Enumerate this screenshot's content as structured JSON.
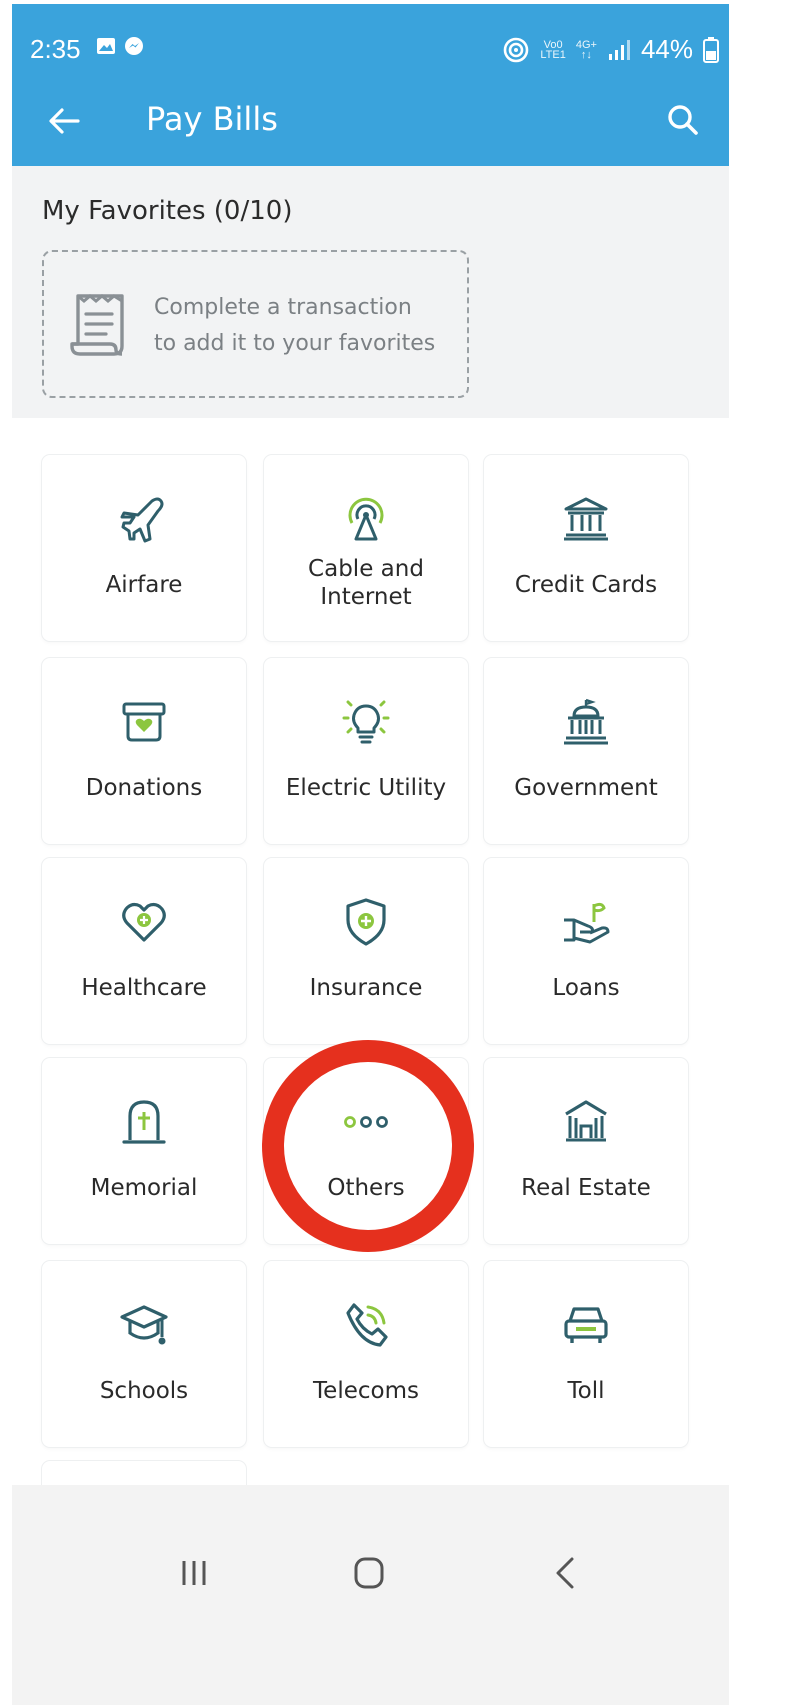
{
  "status_bar": {
    "time": "2:35",
    "network_top": "Vo0",
    "network_bottom": "LTE1",
    "net_top2": "4G+",
    "battery": "44%"
  },
  "app_bar": {
    "title": "Pay Bills"
  },
  "favorites": {
    "title": "My Favorites (0/10)",
    "empty_line1": "Complete a transaction",
    "empty_line2": "to add it to your favorites"
  },
  "categories": [
    {
      "label": "Airfare",
      "icon": "airplane-icon"
    },
    {
      "label": "Cable and\nInternet",
      "icon": "antenna-icon"
    },
    {
      "label": "Credit Cards",
      "icon": "bank-icon"
    },
    {
      "label": "Donations",
      "icon": "donation-box-icon"
    },
    {
      "label": "Electric Utility",
      "icon": "lightbulb-icon"
    },
    {
      "label": "Government",
      "icon": "government-building-icon"
    },
    {
      "label": "Healthcare",
      "icon": "heart-plus-icon"
    },
    {
      "label": "Insurance",
      "icon": "shield-plus-icon"
    },
    {
      "label": "Loans",
      "icon": "hand-plant-icon"
    },
    {
      "label": "Memorial",
      "icon": "tombstone-icon"
    },
    {
      "label": "Others",
      "icon": "more-dots-icon"
    },
    {
      "label": "Real Estate",
      "icon": "house-building-icon"
    },
    {
      "label": "Schools",
      "icon": "graduation-cap-icon"
    },
    {
      "label": "Telecoms",
      "icon": "phone-icon"
    },
    {
      "label": "Toll",
      "icon": "car-icon"
    }
  ],
  "colors": {
    "app_bar": "#3aa3dc",
    "icon_dark": "#2f5f6b",
    "icon_green": "#8cc63f",
    "annotation_red": "#e5301e"
  }
}
